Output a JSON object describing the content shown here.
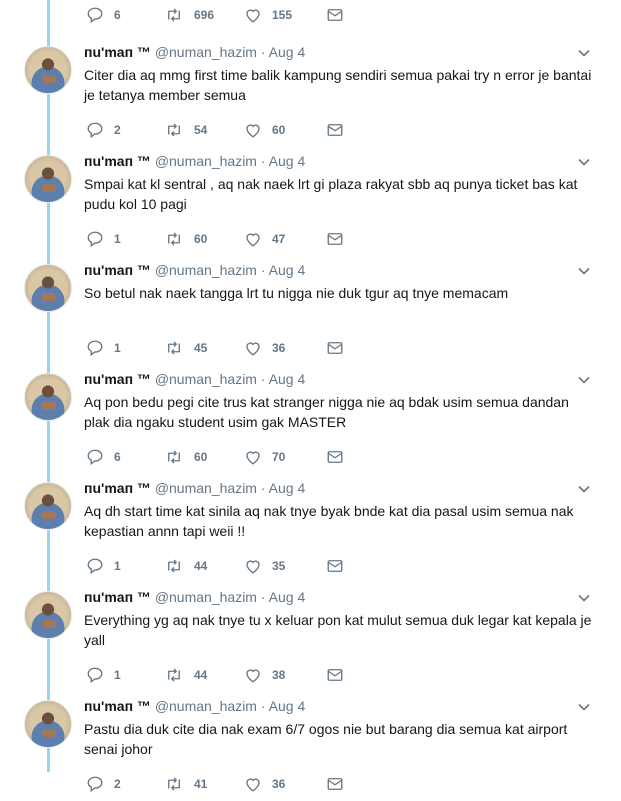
{
  "top_stats": {
    "replies": "6",
    "retweets": "696",
    "likes": "155"
  },
  "tweets": [
    {
      "name": "ᴨu'maᴨ ™",
      "handle": "@numan_hazim",
      "sep": "·",
      "date": "Aug 4",
      "text": "Citer dia aq mmg first time balik kampung sendiri semua pakai try n error je bantai je tetanya member semua",
      "replies": "2",
      "retweets": "54",
      "likes": "60"
    },
    {
      "name": "ᴨu'maᴨ ™",
      "handle": "@numan_hazim",
      "sep": "·",
      "date": "Aug 4",
      "text": "Smpai kat kl sentral , aq nak naek lrt gi plaza rakyat sbb aq punya ticket bas kat pudu kol 10 pagi",
      "replies": "1",
      "retweets": "60",
      "likes": "47"
    },
    {
      "name": "ᴨu'maᴨ ™",
      "handle": "@numan_hazim",
      "sep": "·",
      "date": "Aug 4",
      "text": "So betul nak naek tangga lrt tu nigga nie duk tgur aq tnye memacam",
      "replies": "1",
      "retweets": "45",
      "likes": "36"
    },
    {
      "name": "ᴨu'maᴨ ™",
      "handle": "@numan_hazim",
      "sep": "·",
      "date": "Aug 4",
      "text": "Aq pon bedu pegi cite trus kat stranger nigga nie aq bdak usim semua dandan plak dia ngaku student usim gak MASTER",
      "replies": "6",
      "retweets": "60",
      "likes": "70"
    },
    {
      "name": "ᴨu'maᴨ ™",
      "handle": "@numan_hazim",
      "sep": "·",
      "date": "Aug 4",
      "text": "Aq dh start time kat sinila aq nak tnye byak bnde kat dia pasal usim semua nak kepastian annn tapi weii !!",
      "replies": "1",
      "retweets": "44",
      "likes": "35"
    },
    {
      "name": "ᴨu'maᴨ ™",
      "handle": "@numan_hazim",
      "sep": "·",
      "date": "Aug 4",
      "text": "Everything yg aq nak tnye tu x keluar pon kat mulut semua duk legar kat kepala je yall",
      "replies": "1",
      "retweets": "44",
      "likes": "38"
    },
    {
      "name": "ᴨu'maᴨ ™",
      "handle": "@numan_hazim",
      "sep": "·",
      "date": "Aug 4",
      "text": "Pastu dia duk cite dia nak exam 6/7 ogos nie but barang dia semua kat airport senai johor",
      "replies": "2",
      "retweets": "41",
      "likes": "36"
    }
  ],
  "colors": {
    "thread_line": "#9bd3ef",
    "icon": "#657786",
    "name": "#14171a"
  }
}
